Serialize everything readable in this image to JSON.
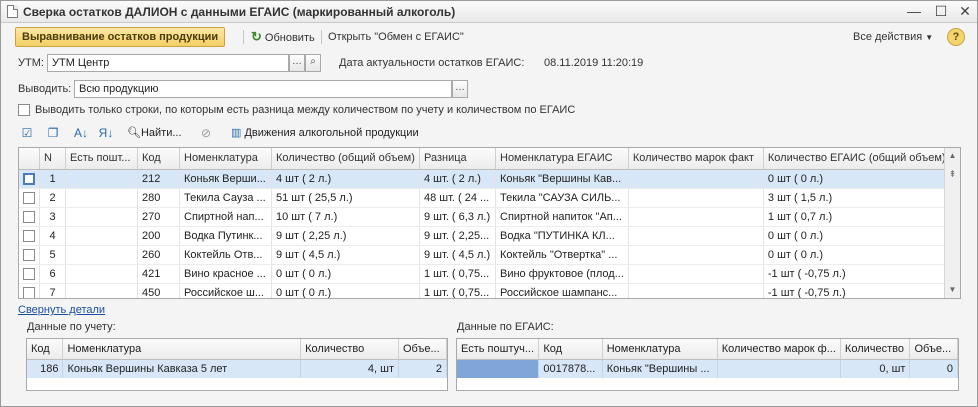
{
  "window": {
    "title": "Сверка остатков ДАЛИОН с данными ЕГАИС (маркированный алкоголь)",
    "min": "—",
    "max": "☐",
    "close": "✕"
  },
  "toolbar": {
    "align_label": "Выравнивание остатков продукции",
    "refresh_label": "Обновить",
    "open_label": "Открыть \"Обмен с ЕГАИС\"",
    "all_actions_label": "Все действия",
    "help_label": "?"
  },
  "form": {
    "utm_label": "УТМ:",
    "utm_value": "УТМ Центр",
    "date_label": "Дата актуальности остатков ЕГАИС:",
    "date_value": "08.11.2019 11:20:19",
    "show_label": "Выводить:",
    "show_value": "Всю продукцию",
    "diff_only_label": "Выводить только строки, по которым есть разница между количеством по учету и количеством по ЕГАИС"
  },
  "table_toolbar": {
    "find_label": "Найти...",
    "movements_label": "Движения алкогольной продукции"
  },
  "grid": {
    "columns": [
      "",
      "N",
      "Есть пошт...",
      "Код",
      "Номенклатура",
      "Количество (общий объем)",
      "Разница",
      "Номенклатура ЕГАИС",
      "Количество марок факт",
      "Количество ЕГАИС (общий объем)"
    ],
    "rows": [
      {
        "n": "1",
        "code": "212",
        "name": "Коньяк Верши...",
        "qty": "4 шт ( 2 л.)",
        "diff": "4 шт. ( 2 л.)",
        "egais_name": "Коньяк \"Вершины Кав...",
        "marks": "",
        "egais_qty": "0 шт ( 0 л.)"
      },
      {
        "n": "2",
        "code": "280",
        "name": "Текила Сауза ...",
        "qty": "51 шт ( 25,5 л.)",
        "diff": "48 шт. ( 24 ...",
        "egais_name": "Текила \"САУЗА СИЛЬ...",
        "marks": "",
        "egais_qty": "3 шт ( 1,5 л.)"
      },
      {
        "n": "3",
        "code": "270",
        "name": "Спиртной нап...",
        "qty": "10 шт ( 7 л.)",
        "diff": "9 шт. ( 6,3 л.)",
        "egais_name": "Спиртной напиток \"Ап...",
        "marks": "",
        "egais_qty": "1 шт ( 0,7 л.)"
      },
      {
        "n": "4",
        "code": "200",
        "name": "Водка Путинк...",
        "qty": "9 шт ( 2,25 л.)",
        "diff": "9 шт. ( 2,25...",
        "egais_name": "Водка \"ПУТИНКА КЛ...",
        "marks": "",
        "egais_qty": "0 шт ( 0 л.)"
      },
      {
        "n": "5",
        "code": "260",
        "name": "Коктейль Отв...",
        "qty": "9 шт ( 4,5 л.)",
        "diff": "9 шт. ( 4,5 л.)",
        "egais_name": "Коктейль \"Отвертка\" ...",
        "marks": "",
        "egais_qty": "0 шт ( 0 л.)"
      },
      {
        "n": "6",
        "code": "421",
        "name": "Вино красное ...",
        "qty": "0 шт ( 0 л.)",
        "diff": "1 шт. ( 0,75...",
        "egais_name": "Вино фруктовое (плод...",
        "marks": "",
        "egais_qty": "-1 шт ( -0,75 л.)"
      },
      {
        "n": "7",
        "code": "450",
        "name": "Российское ш...",
        "qty": "0 шт ( 0 л.)",
        "diff": "1 шт. ( 0,75...",
        "egais_name": "Российское шампанс...",
        "marks": "",
        "egais_qty": "-1 шт ( -0,75 л.)"
      }
    ]
  },
  "details": {
    "collapse_link": "Свернуть детали",
    "accounting_title": "Данные по учету:",
    "accounting_columns": [
      "Код",
      "Номенклатура",
      "Количество",
      "Объе..."
    ],
    "accounting_row": {
      "code": "186",
      "name": "Коньяк Вершины Кавказа 5 лет",
      "qty": "4, шт",
      "vol": "2"
    },
    "egais_title": "Данные по ЕГАИС:",
    "egais_columns": [
      "Есть поштуч...",
      "Код",
      "Номенклатура",
      "Количество марок ф...",
      "Количество",
      "Объе..."
    ],
    "egais_row": {
      "piece": "",
      "code": "0017878...",
      "name": "Коньяк \"Вершины ...",
      "marks": "",
      "qty": "0, шт",
      "vol": "0"
    }
  }
}
